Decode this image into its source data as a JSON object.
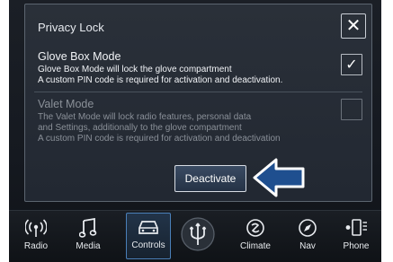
{
  "dialog": {
    "title": "Privacy Lock",
    "close_label": "✕"
  },
  "options": [
    {
      "title": "Glove Box Mode",
      "desc1": "Glove Box Mode will lock the glove compartment",
      "desc2": "A custom PIN code is required for activation and deactivation.",
      "checked": true,
      "check_glyph": "✓"
    },
    {
      "title": "Valet Mode",
      "desc1": "The Valet Mode will lock radio features, personal data",
      "desc2": "and Settings, additionally to the glove compartment",
      "desc3": "A custom PIN code is required for activation and deactivation",
      "checked": false
    }
  ],
  "deactivate_label": "Deactivate",
  "nav": [
    {
      "label": "Radio",
      "icon": "radio-icon"
    },
    {
      "label": "Media",
      "icon": "music-note-icon"
    },
    {
      "label": "Controls",
      "icon": "car-icon",
      "selected": true
    },
    {
      "label": "",
      "icon": "trident-logo-icon"
    },
    {
      "label": "Climate",
      "icon": "climate-icon"
    },
    {
      "label": "Nav",
      "icon": "compass-icon"
    },
    {
      "label": "Phone",
      "icon": "phone-icon"
    }
  ],
  "colors": {
    "accent": "#4a7fb8",
    "arrow_fill": "#1f4f8f"
  }
}
